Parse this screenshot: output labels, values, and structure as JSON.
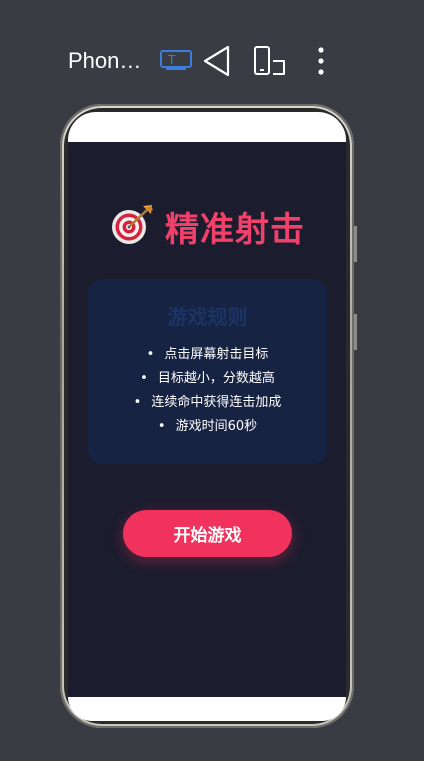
{
  "toolbar": {
    "device_name": "Phon…",
    "icons": [
      "text-input-icon",
      "back-triangle-icon",
      "rotate-device-icon",
      "more-vert-icon"
    ],
    "accent_color": "#3b7ddd"
  },
  "game": {
    "title_emoji": "🎯",
    "title": "精准射击",
    "title_color": "#f1416a",
    "rules": {
      "heading": "游戏规则",
      "items": [
        "点击屏幕射击目标",
        "目标越小，分数越高",
        "连续命中获得连击加成",
        "游戏时间60秒"
      ]
    },
    "start_button": "开始游戏",
    "button_color": "#f0325d"
  }
}
